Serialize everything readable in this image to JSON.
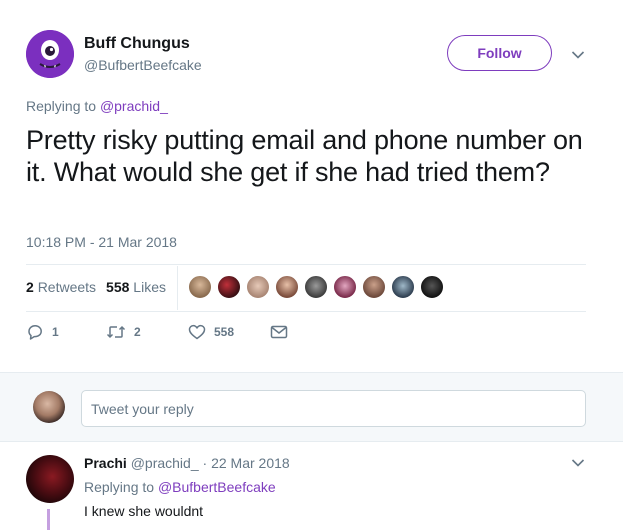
{
  "tweet": {
    "author_name": "Buff Chungus",
    "author_handle": "@BufbertBeefcake",
    "follow_label": "Follow",
    "replying_prefix": "Replying to",
    "replying_to": "@prachid_",
    "text": "Pretty risky putting email and phone number on it. What would she get if she had tried them?",
    "timestamp": "10:18 PM - 21 Mar 2018",
    "retweets_count": "2",
    "retweets_label": "Retweets",
    "likes_count": "558",
    "likes_label": "Likes",
    "liker_count": 9,
    "actions": {
      "reply_count": "1",
      "retweet_count": "2",
      "like_count": "558"
    }
  },
  "reply_box": {
    "placeholder": "Tweet your reply"
  },
  "reply": {
    "author_name": "Prachi",
    "author_handle": "@prachid_",
    "date": "22 Mar 2018",
    "separator": "·",
    "replying_prefix": "Replying to",
    "replying_to": "@BufbertBeefcake",
    "text": "I knew she wouldnt"
  },
  "colors": {
    "accent": "#7e3dbe",
    "avatar_purple": "#7b2fbf",
    "muted_text": "#657786",
    "primary_text": "#14171a",
    "reply_bar_bg": "#f5f8fa"
  },
  "icons": [
    "monster-avatar-icon",
    "chevron-down-icon",
    "reply-icon",
    "retweet-icon",
    "heart-icon",
    "envelope-icon"
  ]
}
